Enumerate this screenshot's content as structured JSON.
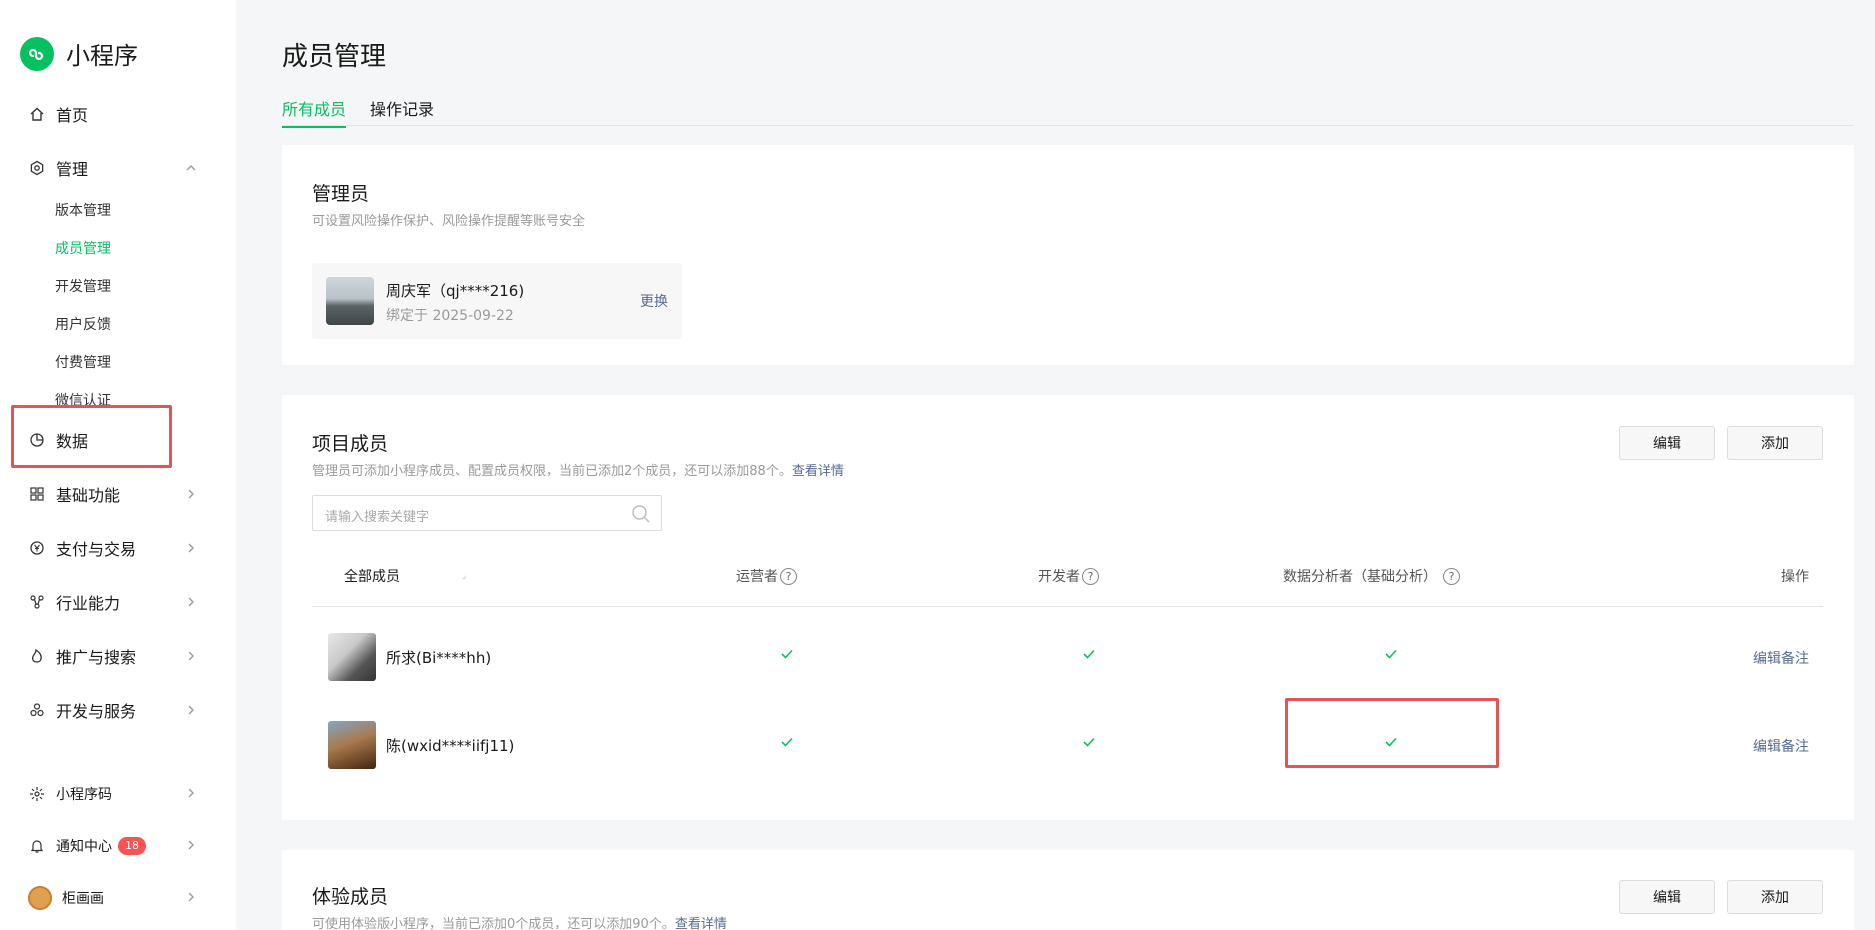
{
  "brand": {
    "title": "小程序"
  },
  "sidebar": {
    "home": "首页",
    "manage": "管理",
    "manage_items": [
      "版本管理",
      "成员管理",
      "开发管理",
      "用户反馈",
      "付费管理",
      "微信认证"
    ],
    "data": "数据",
    "basic": "基础功能",
    "pay": "支付与交易",
    "industry": "行业能力",
    "promo": "推广与搜索",
    "devsvc": "开发与服务",
    "qrcode": "小程序码",
    "notify": "通知中心",
    "notify_count": "18",
    "user": "柜画画"
  },
  "page": {
    "title": "成员管理",
    "tabs": [
      "所有成员",
      "操作记录"
    ]
  },
  "admin_card": {
    "title": "管理员",
    "desc": "可设置风险操作保护、风险操作提醒等账号安全",
    "name": "周庆军（qj****216)",
    "date": "绑定于 2025-09-22",
    "change": "更换"
  },
  "project_card": {
    "title": "项目成员",
    "desc": "管理员可添加小程序成员、配置成员权限，当前已添加2个成员，还可以添加88个。",
    "desc_link": "查看详情",
    "edit": "编辑",
    "add": "添加",
    "search_placeholder": "请输入搜索关键字",
    "columns": {
      "all": "全部成员",
      "operator": "运营者",
      "developer": "开发者",
      "analyst": "数据分析者（基础分析）",
      "action": "操作"
    },
    "rows": [
      {
        "name": "所求(Bi****hh)",
        "operator": true,
        "developer": true,
        "analyst": true,
        "action": "编辑备注"
      },
      {
        "name": "陈(wxid****iifj11)",
        "operator": true,
        "developer": true,
        "analyst": true,
        "action": "编辑备注"
      }
    ]
  },
  "trial_card": {
    "title": "体验成员",
    "desc": "可使用体验版小程序，当前已添加0个成员，还可以添加90个。",
    "desc_link": "查看详情",
    "edit": "编辑",
    "add": "添加"
  },
  "colors": {
    "accent": "#07c160",
    "link": "#576b95",
    "highlight": "#e05555",
    "badge": "#fa5151"
  }
}
